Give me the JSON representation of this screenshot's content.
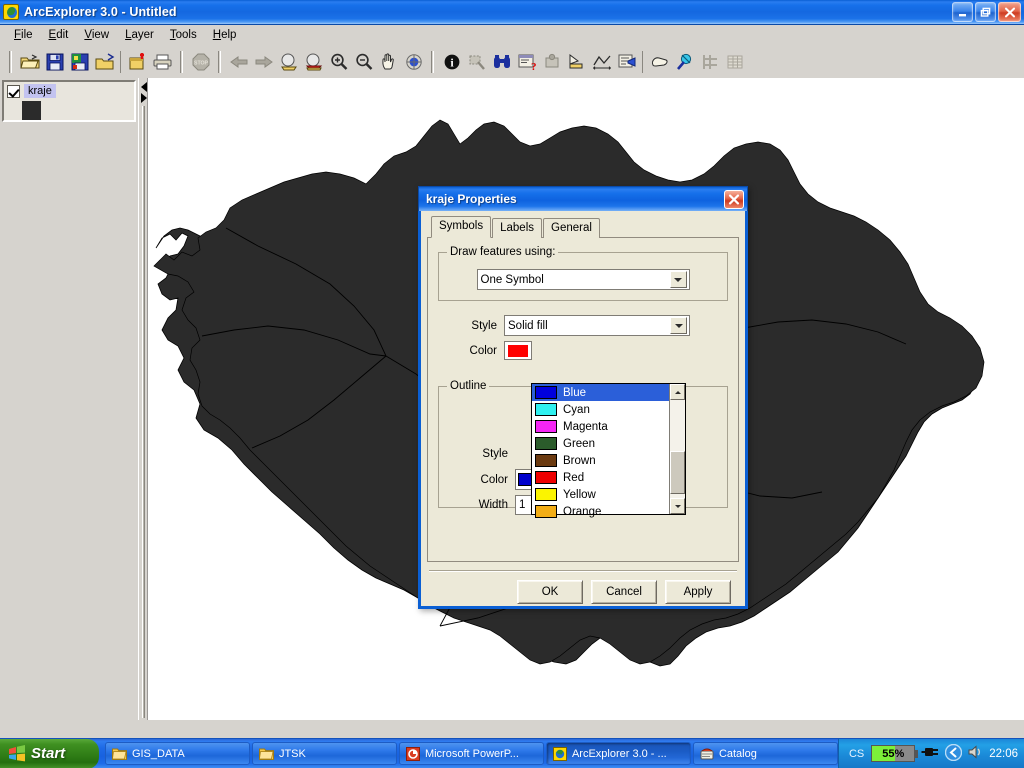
{
  "window": {
    "title": "ArcExplorer 3.0 - Untitled",
    "app_icon": "arcexplorer-globe-icon",
    "minimize_label": "Minimize",
    "maximize_label": "Maximize",
    "close_label": "Close"
  },
  "menu": {
    "items": [
      {
        "label": "File",
        "mnemonic": "F"
      },
      {
        "label": "Edit",
        "mnemonic": "E"
      },
      {
        "label": "View",
        "mnemonic": "V"
      },
      {
        "label": "Layer",
        "mnemonic": "L"
      },
      {
        "label": "Tools",
        "mnemonic": "T"
      },
      {
        "label": "Help",
        "mnemonic": "H"
      }
    ]
  },
  "toolbar": {
    "buttons": [
      {
        "name": "open-folder-icon",
        "enabled": true
      },
      {
        "name": "save-icon",
        "enabled": true
      },
      {
        "name": "save-project-icon",
        "enabled": true
      },
      {
        "name": "open-project-icon",
        "enabled": true
      },
      {
        "name": "add-layer-icon",
        "enabled": true
      },
      {
        "name": "print-icon",
        "enabled": true
      },
      {
        "name": "stop-icon",
        "enabled": false
      },
      {
        "name": "previous-extent-icon",
        "enabled": false
      },
      {
        "name": "next-extent-icon",
        "enabled": false
      },
      {
        "name": "zoom-to-full-extent-icon",
        "enabled": true
      },
      {
        "name": "zoom-to-active-layer-icon",
        "enabled": true
      },
      {
        "name": "zoom-in-icon",
        "enabled": true
      },
      {
        "name": "zoom-out-icon",
        "enabled": true
      },
      {
        "name": "pan-hand-icon",
        "enabled": true
      },
      {
        "name": "globe-icon",
        "enabled": true
      },
      {
        "name": "identify-icon",
        "enabled": true
      },
      {
        "name": "select-features-icon",
        "enabled": false
      },
      {
        "name": "find-binoculars-icon",
        "enabled": true
      },
      {
        "name": "query-builder-icon",
        "enabled": true
      },
      {
        "name": "address-match-icon",
        "enabled": false
      },
      {
        "name": "measure-icon",
        "enabled": true
      },
      {
        "name": "measure-distance-icon",
        "enabled": true
      },
      {
        "name": "layer-properties-icon",
        "enabled": true
      },
      {
        "name": "eraser-icon",
        "enabled": true
      },
      {
        "name": "map-tips-icon",
        "enabled": true
      },
      {
        "name": "grid-icon",
        "enabled": false
      },
      {
        "name": "attribute-table-icon",
        "enabled": false
      }
    ]
  },
  "layer_panel": {
    "layers": [
      {
        "name": "kraje",
        "checked": true,
        "swatch_color": "#2b2b2b",
        "selected": true
      }
    ],
    "splitter_left_label": "collapse",
    "splitter_right_label": "expand"
  },
  "map": {
    "background_color": "#ffffff",
    "feature_fill": "#2b2b2b",
    "feature_outline": "#000000",
    "description": "Czech Republic regions (kraje) silhouette"
  },
  "dialog": {
    "title": "kraje Properties",
    "close_label": "Close",
    "tabs": [
      {
        "label": "Symbols",
        "active": true
      },
      {
        "label": "Labels",
        "active": false
      },
      {
        "label": "General",
        "active": false
      }
    ],
    "draw_features_group": {
      "legend": "Draw features using:",
      "combo_value": "One Symbol"
    },
    "fill": {
      "style_label": "Style",
      "style_value": "Solid fill",
      "color_label": "Color",
      "color_value": "#ff0000"
    },
    "outline_group": {
      "legend": "Outline",
      "style_label": "Style",
      "color_label": "Color",
      "color_value_name": "Blue",
      "color_value": "#0000cc",
      "width_label": "Width",
      "width_value": "1"
    },
    "color_dropdown": {
      "open": true,
      "selected": "Blue",
      "options": [
        {
          "label": "Blue",
          "color": "#0000dd",
          "selected": true
        },
        {
          "label": "Cyan",
          "color": "#2ff0f0",
          "selected": false
        },
        {
          "label": "Magenta",
          "color": "#f525f5",
          "selected": false
        },
        {
          "label": "Green",
          "color": "#2b5c2b",
          "selected": false
        },
        {
          "label": "Brown",
          "color": "#6b3a10",
          "selected": false
        },
        {
          "label": "Red",
          "color": "#ee0000",
          "selected": false
        },
        {
          "label": "Yellow",
          "color": "#fbf400",
          "selected": false
        },
        {
          "label": "Orange",
          "color": "#f2ad15",
          "selected": false
        }
      ]
    },
    "buttons": [
      {
        "label": "OK"
      },
      {
        "label": "Cancel"
      },
      {
        "label": "Apply"
      }
    ]
  },
  "taskbar": {
    "start_label": "Start",
    "tasks": [
      {
        "label": "GIS_DATA",
        "icon": "folder-icon",
        "active": false
      },
      {
        "label": "JTSK",
        "icon": "folder-icon",
        "active": false
      },
      {
        "label": "Microsoft PowerP...",
        "icon": "powerpoint-icon",
        "active": false
      },
      {
        "label": "ArcExplorer 3.0 - ...",
        "icon": "arcexplorer-globe-icon",
        "active": true
      },
      {
        "label": "Catalog",
        "icon": "arccatalog-icon",
        "active": false
      }
    ],
    "tray": {
      "language": "CS",
      "battery_percent": "55%",
      "battery_level": 55,
      "power_icon": "power-plug-icon",
      "show_hidden_icon": "chevron-left-icon",
      "volume_icon": "speaker-icon",
      "clock": "22:06"
    }
  }
}
